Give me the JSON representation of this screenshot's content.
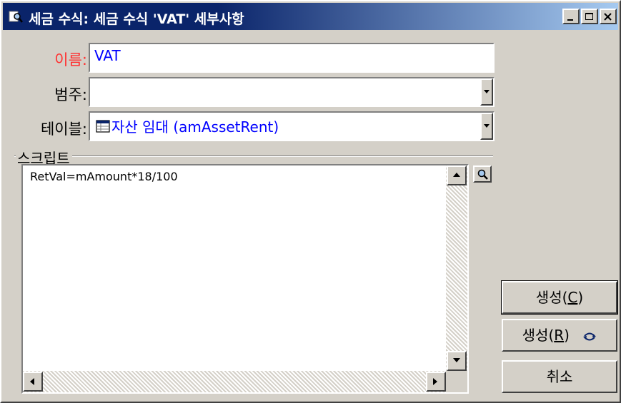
{
  "window": {
    "title": "세금 수식: 세금 수식 'VAT' 세부사항",
    "icon": "magnifier-document-icon"
  },
  "form": {
    "name_label": "이름:",
    "name_value": "VAT",
    "category_label": "범주:",
    "category_value": "",
    "table_label": "테이블:",
    "table_value": "자산 임대 (amAssetRent)"
  },
  "script": {
    "group_label": "스크립트",
    "content": "RetVal=mAmount*18/100"
  },
  "buttons": {
    "create1_label": "생성(",
    "create1_key": "C",
    "create1_end": ")",
    "create2_label": "생성(",
    "create2_key": "R",
    "create2_end": ")",
    "cancel_label": "취소"
  },
  "colors": {
    "titlebar_start": "#0a246a",
    "titlebar_end": "#a6caf0",
    "required_label": "#ff3030",
    "field_value": "#0000ff",
    "face": "#d4d0c8"
  }
}
